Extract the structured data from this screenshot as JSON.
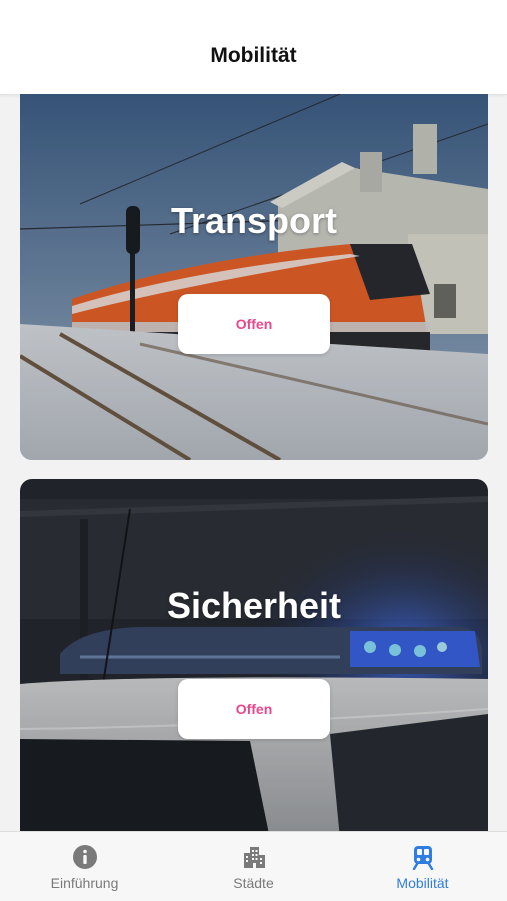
{
  "header": {
    "title": "Mobilität"
  },
  "cards": [
    {
      "title": "Transport",
      "button_label": "Offen"
    },
    {
      "title": "Sicherheit",
      "button_label": "Offen"
    }
  ],
  "tabbar": {
    "items": [
      {
        "label": "Einführung",
        "icon": "info-icon",
        "active": false
      },
      {
        "label": "Städte",
        "icon": "city-icon",
        "active": false
      },
      {
        "label": "Mobilität",
        "icon": "train-icon",
        "active": true
      }
    ]
  },
  "colors": {
    "accent_pink": "#e8488c",
    "active_tab_blue": "#2f7de1",
    "inactive_tab_gray": "#7a7a7a"
  }
}
